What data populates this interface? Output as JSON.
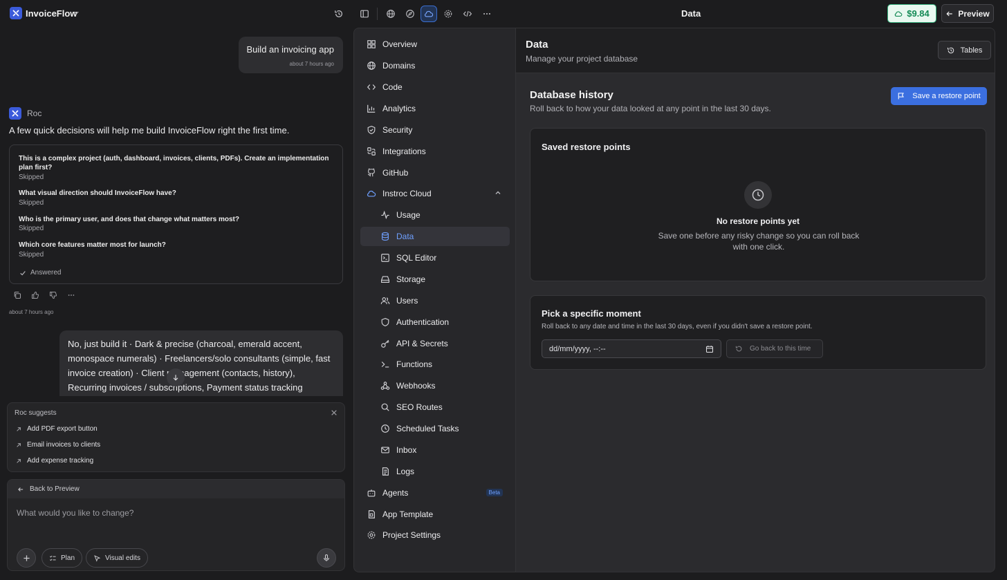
{
  "topbar": {
    "app_name": "InvoiceFlow",
    "page_title": "Data",
    "credit": "$9.84",
    "preview_label": "Preview",
    "icons": [
      "history-icon",
      "sidebar-toggle-icon",
      "globe-icon",
      "compass-icon",
      "cloud-icon",
      "settings-icon",
      "code-icon",
      "more-icon"
    ]
  },
  "chat": {
    "user_msg_1": {
      "text": "Build an invoicing app",
      "time": "about 7 hours ago"
    },
    "assistant": {
      "name": "Roc",
      "message": "A few quick decisions will help me build InvoiceFlow right the first time.",
      "questions": [
        {
          "q": "This is a complex project (auth, dashboard, invoices, clients, PDFs). Create an implementation plan first?",
          "status": "Skipped"
        },
        {
          "q": "What visual direction should InvoiceFlow have?",
          "status": "Skipped"
        },
        {
          "q": "Who is the primary user, and does that change what matters most?",
          "status": "Skipped"
        },
        {
          "q": "Which core features matter most for launch?",
          "status": "Skipped"
        }
      ],
      "answered_label": "Answered",
      "time": "about 7 hours ago"
    },
    "user_msg_2": "No, just build it · Dark & precise (charcoal, emerald accent, monospace numerals) · Freelancers/solo consultants (simple, fast invoice creation) · Client management (contacts, history), Recurring invoices / subscriptions, Payment status tracking"
  },
  "suggestions": {
    "title": "Roc suggests",
    "items": [
      "Add PDF export button",
      "Email invoices to clients",
      "Add expense tracking"
    ]
  },
  "composer": {
    "back_label": "Back to Preview",
    "placeholder": "What would you like to change?",
    "plan_label": "Plan",
    "visual_label": "Visual edits"
  },
  "nav": {
    "items": [
      {
        "label": "Overview",
        "icon": "overview-icon"
      },
      {
        "label": "Domains",
        "icon": "globe-icon"
      },
      {
        "label": "Code",
        "icon": "code-icon"
      },
      {
        "label": "Analytics",
        "icon": "bar-chart-icon"
      },
      {
        "label": "Security",
        "icon": "shield-icon"
      },
      {
        "label": "Integrations",
        "icon": "integrations-icon"
      },
      {
        "label": "GitHub",
        "icon": "github-icon"
      },
      {
        "label": "Instroc Cloud",
        "icon": "cloud-icon"
      }
    ],
    "cloud_items": [
      {
        "label": "Usage",
        "icon": "activity-icon"
      },
      {
        "label": "Data",
        "icon": "database-icon",
        "active": true
      },
      {
        "label": "SQL Editor",
        "icon": "terminal-square-icon"
      },
      {
        "label": "Storage",
        "icon": "hard-drive-icon"
      },
      {
        "label": "Users",
        "icon": "users-icon"
      },
      {
        "label": "Authentication",
        "icon": "shield-icon"
      },
      {
        "label": "API & Secrets",
        "icon": "key-icon"
      },
      {
        "label": "Functions",
        "icon": "terminal-icon"
      },
      {
        "label": "Webhooks",
        "icon": "webhook-icon"
      },
      {
        "label": "SEO Routes",
        "icon": "search-icon"
      },
      {
        "label": "Scheduled Tasks",
        "icon": "clock-icon"
      },
      {
        "label": "Inbox",
        "icon": "mail-icon"
      },
      {
        "label": "Logs",
        "icon": "logs-icon"
      }
    ],
    "bottom_items": [
      {
        "label": "Agents",
        "icon": "bot-icon",
        "badge": "Beta"
      },
      {
        "label": "App Template",
        "icon": "template-icon"
      },
      {
        "label": "Project Settings",
        "icon": "settings-icon"
      }
    ]
  },
  "main": {
    "title": "Data",
    "subtitle": "Manage your project database",
    "tables_label": "Tables",
    "history": {
      "title": "Database history",
      "subtitle": "Roll back to how your data looked at any point in the last 30 days.",
      "save_label": "Save a restore point"
    },
    "restore_points": {
      "title": "Saved restore points",
      "empty_title": "No restore points yet",
      "empty_sub": "Save one before any risky change so you can roll back with one click."
    },
    "moment": {
      "title": "Pick a specific moment",
      "subtitle": "Roll back to any date and time in the last 30 days, even if you didn't save a restore point.",
      "input_value": "dd/mm/yyyy, --:--",
      "go_back_label": "Go back to this time"
    }
  },
  "colors": {
    "accent": "#3b6fe0",
    "credit": "#138a55",
    "active_nav": "#6fa0ff"
  }
}
